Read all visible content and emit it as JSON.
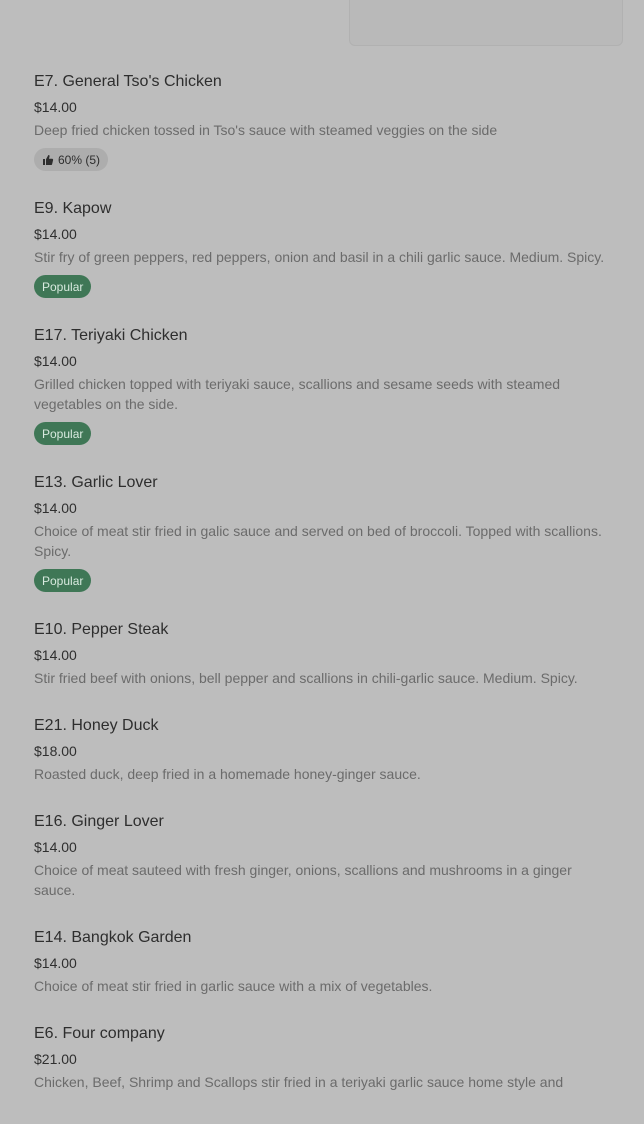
{
  "top": {
    "cut_text": "· ·"
  },
  "items": [
    {
      "title": "E7. General Tso's Chicken",
      "price": "$14.00",
      "description": "Deep fried chicken tossed in Tso's sauce with steamed veggies on the side",
      "badge": {
        "type": "like",
        "text": "60% (5)"
      }
    },
    {
      "title": "E9. Kapow",
      "price": "$14.00",
      "description": "Stir fry of green peppers, red peppers, onion and basil in a chili garlic sauce. Medium. Spicy.",
      "badge": {
        "type": "popular",
        "text": "Popular"
      }
    },
    {
      "title": "E17. Teriyaki Chicken",
      "price": "$14.00",
      "description": "Grilled chicken topped with teriyaki sauce, scallions and sesame seeds with steamed vegetables on the side.",
      "badge": {
        "type": "popular",
        "text": "Popular"
      }
    },
    {
      "title": "E13. Garlic Lover",
      "price": "$14.00",
      "description": "Choice of meat stir fried in galic sauce and served on bed of broccoli. Topped with scallions. Spicy.",
      "badge": {
        "type": "popular",
        "text": "Popular"
      }
    },
    {
      "title": "E10. Pepper Steak",
      "price": "$14.00",
      "description": "Stir fried beef with onions, bell pepper and scallions in chili-garlic sauce. Medium. Spicy."
    },
    {
      "title": "E21. Honey Duck",
      "price": "$18.00",
      "description": "Roasted duck, deep fried in a homemade honey-ginger sauce."
    },
    {
      "title": "E16. Ginger Lover",
      "price": "$14.00",
      "description": "Choice of meat sauteed with fresh ginger, onions, scallions and mushrooms in a ginger sauce."
    },
    {
      "title": "E14. Bangkok Garden",
      "price": "$14.00",
      "description": "Choice of meat stir fried in garlic sauce with a mix of vegetables."
    },
    {
      "title": "E6. Four company",
      "price": "$21.00",
      "description": "Chicken, Beef, Shrimp and Scallops stir fried in a teriyaki garlic sauce home style and"
    }
  ]
}
